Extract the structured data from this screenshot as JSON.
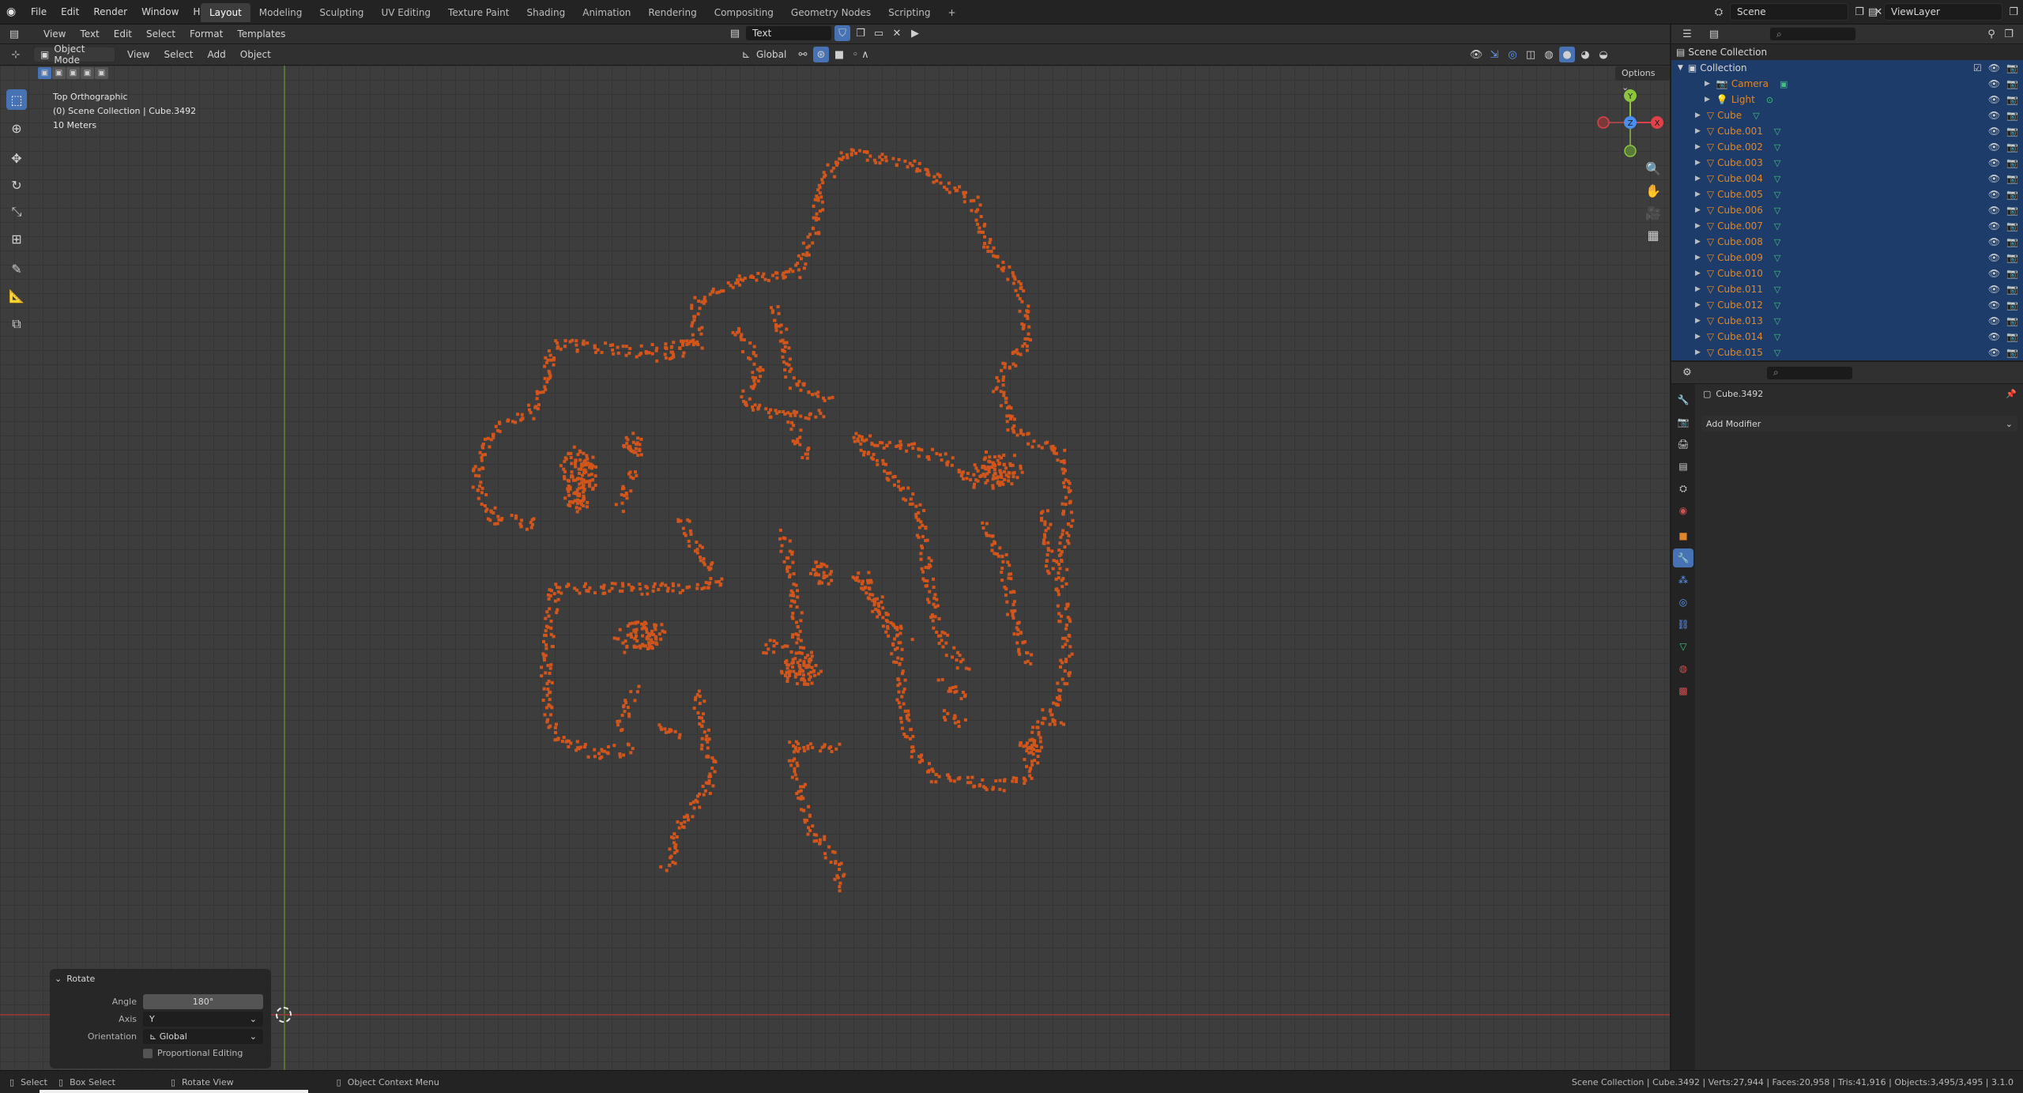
{
  "topbar": {
    "menu": [
      "File",
      "Edit",
      "Render",
      "Window",
      "Help"
    ],
    "workspaces": [
      "Layout",
      "Modeling",
      "Sculpting",
      "UV Editing",
      "Texture Paint",
      "Shading",
      "Animation",
      "Rendering",
      "Compositing",
      "Geometry Nodes",
      "Scripting"
    ],
    "active_workspace": "Layout",
    "add_tab": "+",
    "text_editor_field": "Text",
    "scene_name": "Scene",
    "view_layer_name": "ViewLayer"
  },
  "text_editor_header": {
    "items": [
      "View",
      "Text",
      "Edit",
      "Select",
      "Format",
      "Templates"
    ]
  },
  "viewport_header": {
    "mode": "Object Mode",
    "items": [
      "View",
      "Select",
      "Add",
      "Object"
    ],
    "orientation": "Global",
    "options_label": "Options"
  },
  "viewport_overlay": {
    "view_name": "Top Orthographic",
    "collection_info": "(0) Scene Collection | Cube.3492",
    "scale": "10 Meters"
  },
  "gizmo": {
    "y": "Y",
    "x": "X",
    "z": "Z"
  },
  "operator_panel": {
    "title": "Rotate",
    "angle_label": "Angle",
    "angle_value": "180°",
    "axis_label": "Axis",
    "axis_value": "Y",
    "orientation_label": "Orientation",
    "orientation_value": "Global",
    "proportional_label": "Proportional Editing"
  },
  "outliner": {
    "root": "Scene Collection",
    "collection": "Collection",
    "items": [
      "Camera",
      "Light",
      "Cube",
      "Cube.001",
      "Cube.002",
      "Cube.003",
      "Cube.004",
      "Cube.005",
      "Cube.006",
      "Cube.007",
      "Cube.008",
      "Cube.009",
      "Cube.010",
      "Cube.011",
      "Cube.012",
      "Cube.013",
      "Cube.014",
      "Cube.015"
    ]
  },
  "properties": {
    "object_name": "Cube.3492",
    "add_modifier": "Add Modifier"
  },
  "statusbar": {
    "select": "Select",
    "box_select": "Box Select",
    "rotate_view": "Rotate View",
    "context_menu": "Object Context Menu",
    "stats": "Scene Collection | Cube.3492 | Verts:27,944 | Faces:20,958 | Tris:41,916 | Objects:3,495/3,495 | 3.1.0"
  },
  "colors": {
    "accent": "#4772b3",
    "selected_object": "#e0872b",
    "cube_fill": "#d2561c",
    "viewport_bg": "#3d3d3d",
    "outliner_selected": "#1d3c6a"
  }
}
